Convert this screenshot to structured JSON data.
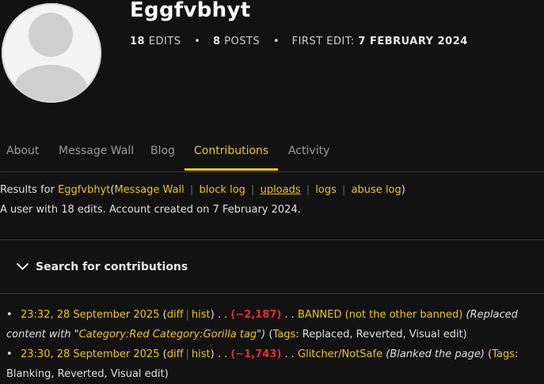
{
  "profile": {
    "username": "Eggfvbhyt",
    "edits_count": "18",
    "edits_label": "EDITS",
    "posts_count": "8",
    "posts_label": "POSTS",
    "first_edit_label": "FIRST EDIT:",
    "first_edit_date": "7 FEBRUARY 2024",
    "separator": "•"
  },
  "tabs": [
    {
      "label": "About"
    },
    {
      "label": "Message Wall"
    },
    {
      "label": "Blog"
    },
    {
      "label": "Contributions",
      "active": true
    },
    {
      "label": "Activity"
    }
  ],
  "results_line": {
    "prefix": "Results for",
    "user": "Eggfvbhyt",
    "open": "(",
    "links": [
      "Message Wall",
      "block log",
      "uploads",
      "logs",
      "abuse log"
    ],
    "close": ")",
    "pipe": "|"
  },
  "account_info": "A user with 18 edits. Account created on 7 February 2024.",
  "search_toggle": "Search for contributions",
  "contributions": [
    {
      "bullet": "•",
      "timestamp": "23:32, 28 September 2025",
      "diff": "diff",
      "hist": "hist",
      "dots": ". .",
      "size_change": "(−2,187)",
      "page": "BANNED (not the other banned)",
      "summary_pre": "(Replaced content with \"",
      "summary_link": "Category:Red Category:Gorilla tag",
      "summary_post": "\")",
      "tags_label": "Tags",
      "tags": ": Replaced, Reverted, Visual edit)"
    },
    {
      "bullet": "•",
      "timestamp": "23:30, 28 September 2025",
      "diff": "diff",
      "hist": "hist",
      "dots": ". .",
      "size_change": "(−1,743)",
      "page": "Glitcher/NotSafe",
      "summary_pre": "(Blanked the page)",
      "tags_label": "Tags",
      "tags": ": Blanking, Reverted, Visual edit)"
    }
  ],
  "colors": {
    "accent": "#f0c419",
    "background": "#121212",
    "negative": "#e03030"
  },
  "icons": {
    "avatar": "default-user-silhouette",
    "search_toggle": "chevron-down-icon"
  }
}
